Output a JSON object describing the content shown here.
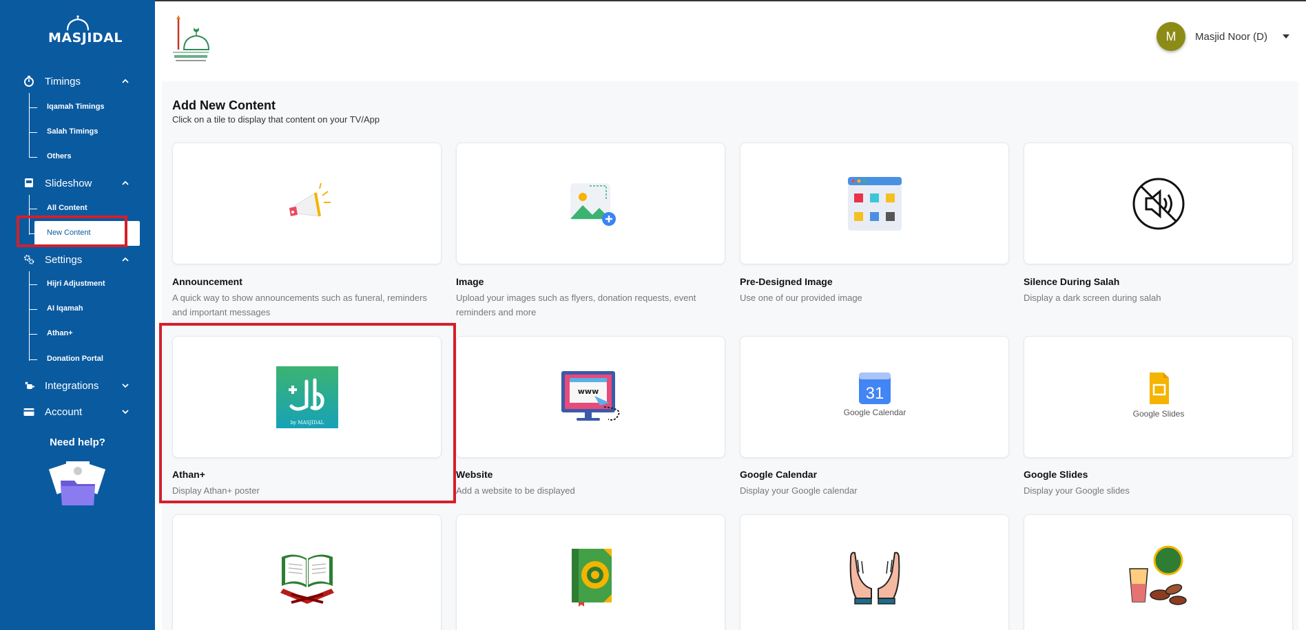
{
  "sidebar": {
    "logo_text": "MASJIDAL",
    "sections": [
      {
        "label": "Timings",
        "expanded": true
      },
      {
        "label": "Slideshow",
        "expanded": true
      },
      {
        "label": "Settings",
        "expanded": true
      },
      {
        "label": "Integrations",
        "expanded": false
      },
      {
        "label": "Account",
        "expanded": false
      }
    ],
    "timings_items": [
      "Iqamah Timings",
      "Salah Timings",
      "Others"
    ],
    "slideshow_items": [
      "All Content",
      "New Content"
    ],
    "settings_items": [
      "Hijri Adjustment",
      "AI Iqamah",
      "Athan+",
      "Donation Portal"
    ],
    "help_label": "Need help?",
    "active_item": "New Content"
  },
  "header": {
    "org_logo_icon": "masjid-noor-logo",
    "user_initial": "M",
    "user_name": "Masjid Noor (D)",
    "avatar_color": "#8b8b16"
  },
  "main": {
    "title": "Add New Content",
    "subtitle": "Click on a tile to display that content on your TV/App",
    "tiles": [
      {
        "title": "Announcement",
        "desc": "A quick way to show announcements such as funeral, reminders and important messages",
        "icon": "megaphone-icon"
      },
      {
        "title": "Image",
        "desc": "Upload your images such as flyers, donation requests, event reminders and more",
        "icon": "image-add-icon"
      },
      {
        "title": "Pre-Designed Image",
        "desc": "Use one of our provided image",
        "icon": "template-grid-icon"
      },
      {
        "title": "Silence During Salah",
        "desc": "Display a dark screen during salah",
        "icon": "mute-icon"
      },
      {
        "title": "Athan+",
        "desc": "Display Athan+ poster",
        "icon": "athan-plus-logo",
        "logo_caption": "by MASJIDAL"
      },
      {
        "title": "Website",
        "desc": "Add a website to be displayed",
        "icon": "website-icon",
        "logo_caption": "www"
      },
      {
        "title": "Google Calendar",
        "desc": "Display your Google calendar",
        "icon": "google-calendar-icon",
        "logo_caption": "Google Calendar",
        "logo_number": "31"
      },
      {
        "title": "Google Slides",
        "desc": "Display your Google slides",
        "icon": "google-slides-icon",
        "logo_caption": "Google Slides"
      },
      {
        "title": "",
        "desc": "",
        "icon": "quran-stand-icon"
      },
      {
        "title": "",
        "desc": "",
        "icon": "quran-book-icon"
      },
      {
        "title": "",
        "desc": "",
        "icon": "dua-hands-icon"
      },
      {
        "title": "",
        "desc": "",
        "icon": "iftar-icon"
      }
    ]
  },
  "colors": {
    "sidebar_bg": "#0a5aa0",
    "highlight": "#d3202b",
    "page_bg": "#f7f8fa"
  }
}
